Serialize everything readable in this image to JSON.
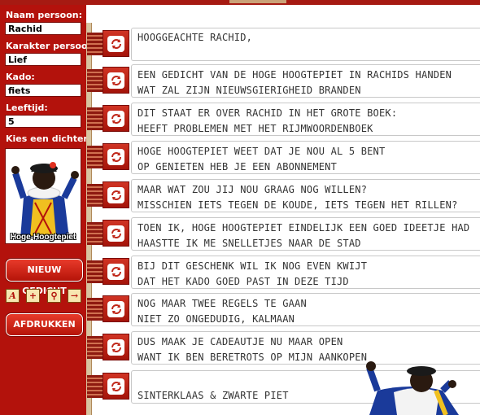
{
  "sidebar": {
    "name_label": "Naam persoon:",
    "name_value": "Rachid",
    "character_label": "Karakter persoon:",
    "character_value": "Lief",
    "gift_label": "Kado:",
    "gift_value": "fiets",
    "age_label": "Leeftijd:",
    "age_value": "5",
    "poet_label": "Kies een dichter:",
    "poet_name": "Hoge-Hoogtepiet",
    "new_poem_button": "NIEUW GEDICHT",
    "print_button": "AFDRUKKEN",
    "tool_icons": [
      "font-icon",
      "add-icon",
      "zoom-icon",
      "export-icon"
    ]
  },
  "poem": {
    "lines": [
      {
        "l1": "HOOGGEACHTE RACHID,",
        "l2": ""
      },
      {
        "l1": "EEN GEDICHT VAN DE HOGE HOOGTEPIET IN RACHIDS HANDEN",
        "l2": "WAT ZAL ZIJN NIEUWSGIERIGHEID BRANDEN"
      },
      {
        "l1": "DIT STAAT ER OVER RACHID IN HET GROTE BOEK:",
        "l2": "HEEFT PROBLEMEN MET HET RIJMWOORDENBOEK"
      },
      {
        "l1": "HOGE HOOGTEPIET WEET DAT JE NOU AL 5 BENT",
        "l2": "OP GENIETEN HEB JE EEN ABONNEMENT"
      },
      {
        "l1": "MAAR WAT ZOU JIJ NOU GRAAG NOG WILLEN?",
        "l2": "MISSCHIEN IETS TEGEN DE KOUDE, IETS TEGEN HET RILLEN?"
      },
      {
        "l1": "TOEN IK, HOGE HOOGTEPIET EINDELIJK EEN GOED IDEETJE HAD",
        "l2": "HAASTTE IK ME SNELLETJES NAAR DE STAD"
      },
      {
        "l1": "BIJ DIT GESCHENK WIL IK NOG EVEN KWIJT",
        "l2": "DAT HET KADO GOED PAST IN DEZE TIJD"
      },
      {
        "l1": "NOG MAAR TWEE REGELS TE GAAN",
        "l2": "NIET ZO ONGEDUDIG, KALMAAN"
      },
      {
        "l1": "DUS MAAK JE CADEAUTJE NU MAAR OPEN",
        "l2": "WANT IK BEN BERETROTS OP MIJN AANKOPEN"
      },
      {
        "l1": "",
        "l2": "SINTERKLAAS & ZWARTE PIET"
      }
    ]
  },
  "colors": {
    "sidebar": "#b3120c",
    "accent": "#a61a12"
  }
}
